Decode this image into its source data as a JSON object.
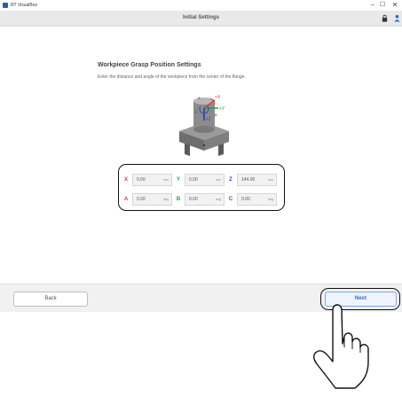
{
  "window": {
    "app_title": "RT VisualBox",
    "controls": {
      "minimize": "–",
      "maximize": "☐",
      "close": "✕"
    }
  },
  "header": {
    "title": "Initial Settings",
    "icons": [
      "lock-icon",
      "person-icon"
    ]
  },
  "section": {
    "title": "Workpiece Grasp Position Settings",
    "description": "Enter the distance and angle of the workpiece from the center of the flange."
  },
  "diagram": {
    "labels": {
      "x": "+X",
      "y": "+Y",
      "z": "+Z",
      "a": "A",
      "b": "B",
      "c": "C"
    }
  },
  "fields": [
    {
      "letter": "X",
      "value": "0.00",
      "unit": "mm",
      "color": "#e53935"
    },
    {
      "letter": "Y",
      "value": "0.00",
      "unit": "mm",
      "color": "#2e9f3b"
    },
    {
      "letter": "Z",
      "value": "144.00",
      "unit": "mm",
      "color": "#2b4fb8"
    },
    {
      "letter": "A",
      "value": "0.00",
      "unit": "deg",
      "color": "#e53935"
    },
    {
      "letter": "B",
      "value": "0.00",
      "unit": "deg",
      "color": "#2e9f3b"
    },
    {
      "letter": "C",
      "value": "0.00",
      "unit": "deg",
      "color": "#2b4fb8"
    }
  ],
  "footer": {
    "back_label": "Back",
    "next_label": "Next"
  },
  "colors": {
    "header_bg": "#e9e9e9",
    "accent": "#2b6bd4"
  }
}
